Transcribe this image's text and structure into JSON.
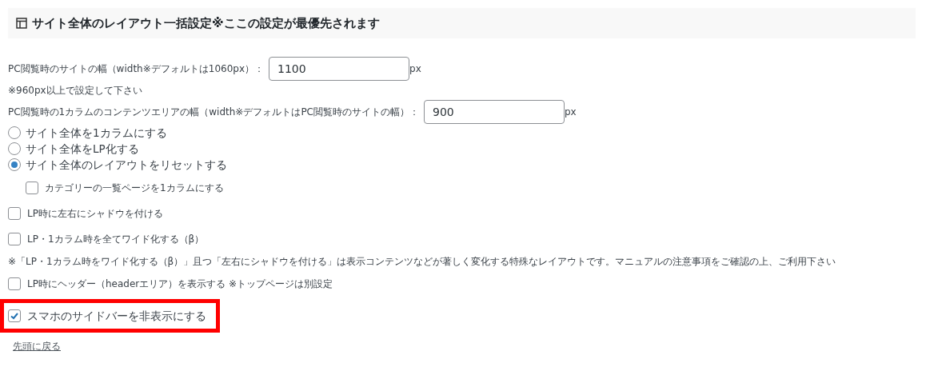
{
  "section": {
    "title": "サイト全体のレイアウト一括設定※ここの設定が最優先されます"
  },
  "rows": [
    {
      "kind": "field",
      "label": "PC閲覧時のサイトの幅（width※デフォルトは1060px）：",
      "value": "1100",
      "unit": "px"
    },
    {
      "kind": "note",
      "text": "※960px以上で設定して下さい"
    },
    {
      "kind": "field",
      "label": "PC閲覧時の1カラムのコンテンツエリアの幅（width※デフォルトはPC閲覧時のサイトの幅）：",
      "value": "900",
      "unit": "px"
    },
    {
      "kind": "radio",
      "label": "サイト全体を1カラムにする",
      "selected": false
    },
    {
      "kind": "radio",
      "label": "サイト全体をLP化する",
      "selected": false
    },
    {
      "kind": "radio",
      "label": "サイト全体のレイアウトをリセットする",
      "selected": true
    },
    {
      "kind": "subcheck",
      "label": "カテゴリーの一覧ページを1カラムにする",
      "checked": false,
      "highlighted": false
    },
    {
      "kind": "check",
      "label": "LP時に左右にシャドウを付ける",
      "checked": false,
      "highlighted": false
    },
    {
      "kind": "check",
      "label": "LP・1カラム時を全てワイド化する（β）",
      "checked": false,
      "highlighted": false
    },
    {
      "kind": "note",
      "text": "※「LP・1カラム時をワイド化する（β）」且つ「左右にシャドウを付ける」は表示コンテンツなどが著しく変化する特殊なレイアウトです。マニュアルの注意事項をご確認の上、ご利用下さい"
    },
    {
      "kind": "check",
      "label": "LP時にヘッダー（headerエリア）を表示する ※トップページは別設定",
      "checked": false,
      "highlighted": false
    },
    {
      "kind": "check",
      "label": "スマホのサイドバーを非表示にする",
      "checked": true,
      "highlighted": true
    }
  ],
  "back_link": "先頭に戻る"
}
